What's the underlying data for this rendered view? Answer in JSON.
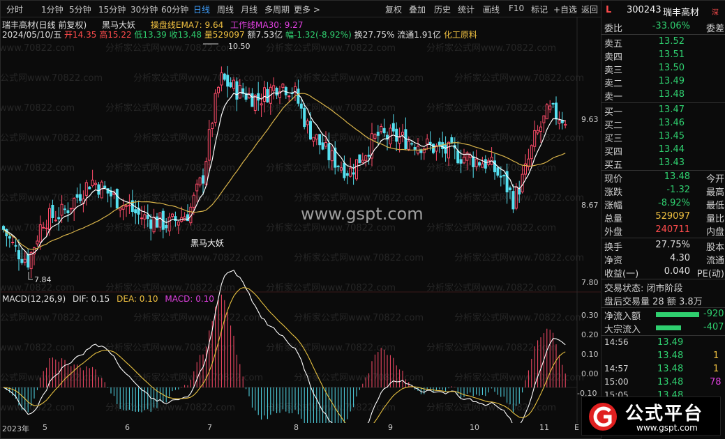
{
  "toolbar": {
    "tabs": [
      "分时",
      "1分钟",
      "5分钟",
      "15分钟",
      "30分钟",
      "60分钟",
      "日线",
      "周线",
      "月线",
      "多周期",
      "更多 >"
    ],
    "active_tab": "日线",
    "buttons": [
      "复权",
      "叠加",
      "历史",
      "统计",
      "画线",
      "F10",
      "标记",
      "+自选",
      "返回"
    ]
  },
  "info": {
    "stock_title": "瑞丰高材(日线 前复权)",
    "indicator": "黑马大妖",
    "ema_label": "操盘线EMA7: 9.64",
    "ma_label": "工作线MA30: 9.27",
    "date": "2024/05/10/五",
    "open": "开14.35",
    "high": "高15.22",
    "low": "低13.39",
    "close": "收13.48",
    "volume": "量529097",
    "amount": "额7.53亿",
    "change": "幅-1.32(-8.92%)",
    "turnover": "换27.75%",
    "float": "流通1.91亿",
    "sector": "化工原料"
  },
  "macd_header": {
    "name": "MACD(12,26,9)",
    "dif": "DIF: 0.15",
    "dea": "DEA: 0.10",
    "macd": "MACD: 0.10"
  },
  "annotations": {
    "high_mark": "10.50",
    "low_mark": "7.84",
    "signal": "黑马大妖",
    "watermark": "www.gspt.com",
    "bg_watermark": "分析家公式网www.70822.com"
  },
  "price_axis": [
    "9.63",
    "8.67",
    "7.80"
  ],
  "macd_axis": [
    "0.30",
    "0.20",
    "0.10",
    "0.00",
    "-0.10"
  ],
  "x_axis": [
    "2023年",
    "5",
    "6",
    "7",
    "8",
    "9",
    "10",
    "11",
    "E"
  ],
  "quote": {
    "market": "L",
    "code": "300243",
    "name": "瑞丰高材",
    "tag": "深",
    "weibi_label": "委比",
    "weibi": "-33.06%",
    "weicha_label": "委差",
    "asks": [
      {
        "label": "卖五",
        "price": "13.52"
      },
      {
        "label": "卖四",
        "price": "13.51"
      },
      {
        "label": "卖三",
        "price": "13.50"
      },
      {
        "label": "卖二",
        "price": "13.49"
      },
      {
        "label": "卖一",
        "price": "13.48"
      }
    ],
    "bids": [
      {
        "label": "买一",
        "price": "13.47"
      },
      {
        "label": "买二",
        "price": "13.46"
      },
      {
        "label": "买三",
        "price": "13.45"
      },
      {
        "label": "买四",
        "price": "13.44"
      },
      {
        "label": "买五",
        "price": "13.43"
      }
    ],
    "stats": [
      {
        "label": "现价",
        "value": "13.48",
        "label2": "今开",
        "color": "green"
      },
      {
        "label": "涨跌",
        "value": "-1.32",
        "label2": "最高",
        "color": "green"
      },
      {
        "label": "涨幅",
        "value": "-8.92%",
        "label2": "最低",
        "color": "green"
      },
      {
        "label": "总量",
        "value": "529097",
        "label2": "量比",
        "color": "yellow"
      },
      {
        "label": "外盘",
        "value": "240711",
        "label2": "内盘",
        "color": "red"
      }
    ],
    "stats2": [
      {
        "label": "换手",
        "value": "27.75%",
        "label2": "股本"
      },
      {
        "label": "净资",
        "value": "4.30",
        "label2": "流通"
      },
      {
        "label": "收益(一)",
        "value": "0.040",
        "label2": "PE(动)"
      }
    ],
    "trade_status": "交易状态: 闭市阶段",
    "after_hours": "盘后交易量 28 额 3.8万",
    "net_inflow_label": "净流入额",
    "net_inflow": "-920",
    "block_inflow_label": "大宗流入",
    "block_inflow": "-407",
    "ticks": [
      {
        "time": "14:56",
        "price": "13.49",
        "vol": ""
      },
      {
        "time": "",
        "price": "13.48",
        "vol": "1"
      },
      {
        "time": "14:57",
        "price": "13.48",
        "vol": "1"
      },
      {
        "time": "15:00",
        "price": "13.48",
        "vol": "78"
      },
      {
        "time": "15:05",
        "price": "13.48",
        "vol": ""
      }
    ]
  },
  "logo": {
    "text": "公式平台",
    "url": "www.gspt.com"
  }
}
